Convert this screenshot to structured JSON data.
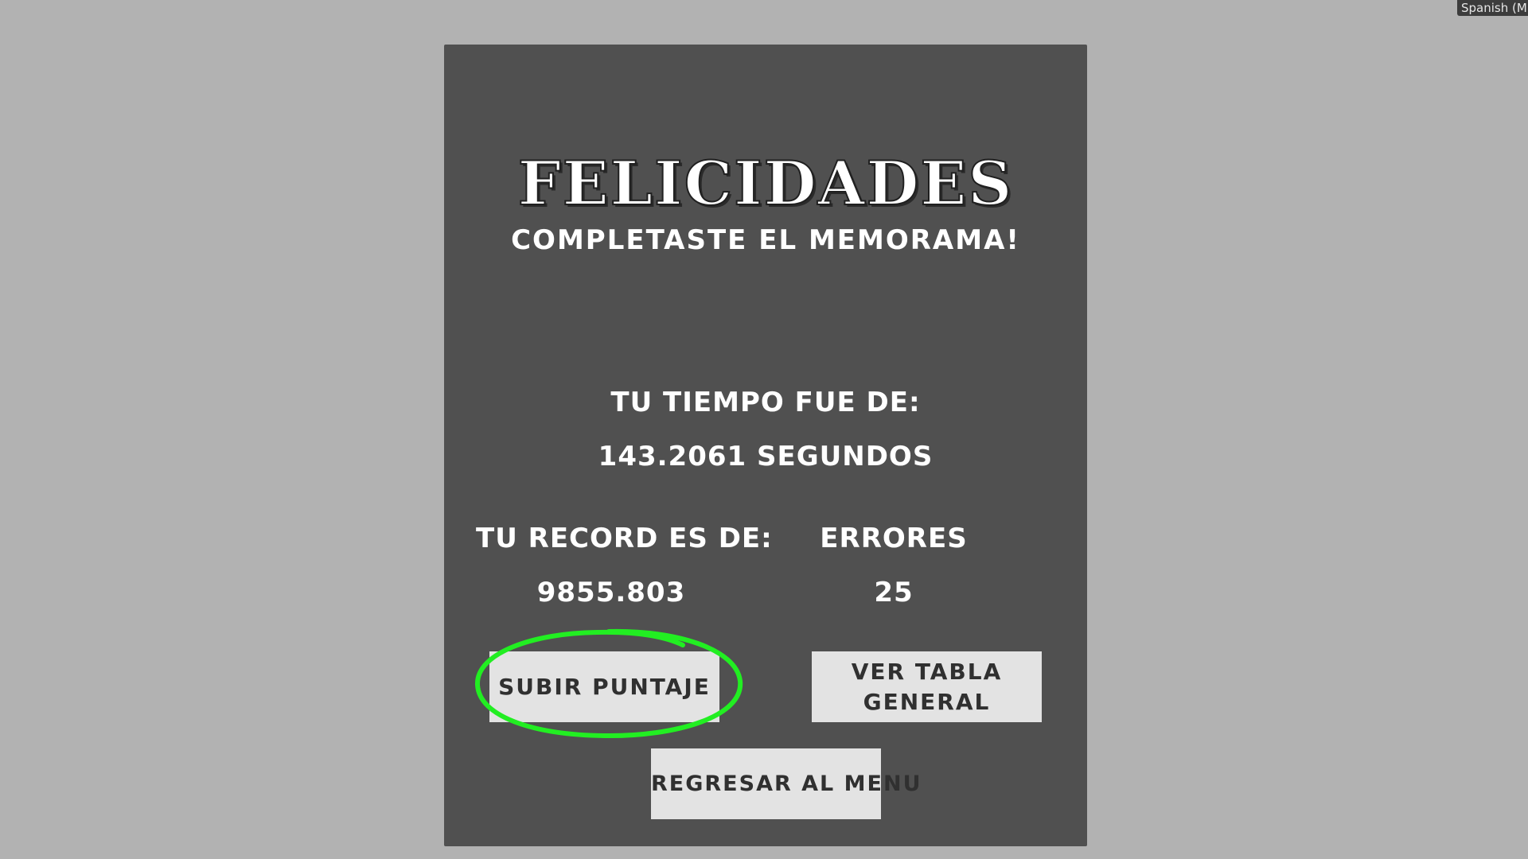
{
  "language_indicator": "Spanish (M",
  "result_panel": {
    "title": "FELICIDADES",
    "subtitle": "completaste el memorama!",
    "time_label": "Tu tiempo fue de:",
    "time_value": "143.2061 segundos",
    "record_label": "Tu record es de:",
    "record_value": "9855.803",
    "errors_label": "errores",
    "errors_value": "25"
  },
  "buttons": {
    "upload_score": "Subir Puntaje",
    "view_table": "Ver Tabla General",
    "back_to_menu": "Regresar al Menu"
  },
  "colors": {
    "background": "#b2b2b2",
    "panel": "#505050",
    "button": "#e3e3e3",
    "highlight": "#22ee22"
  }
}
